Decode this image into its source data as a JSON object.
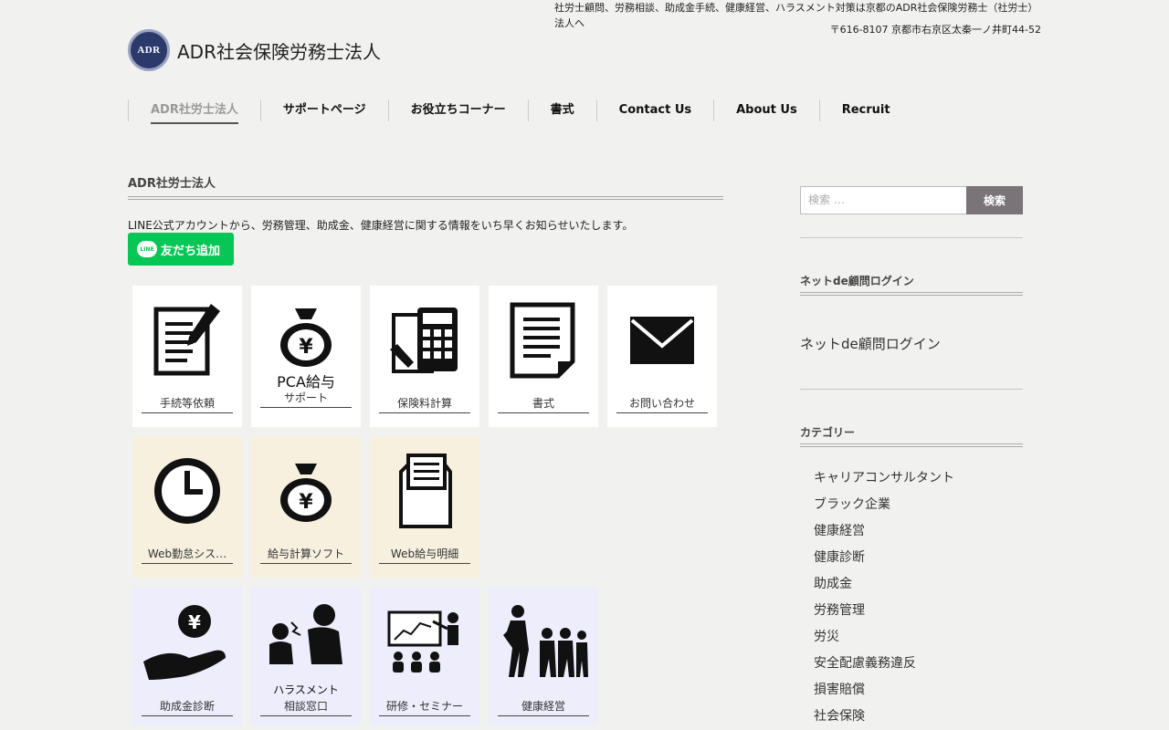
{
  "header": {
    "tagline": "社労士顧問、労務相談、助成金手続、健康経営、ハラスメント対策は京都のADR社会保険労務士（社労士）法人へ",
    "address": "〒616-8107 京都市右京区太秦一ノ井町44-52",
    "logo_mark": "ADR",
    "logo_text": "ADR社会保険労務士法人"
  },
  "nav": {
    "items": [
      {
        "label": "ADR社労士法人"
      },
      {
        "label": "サポートページ"
      },
      {
        "label": "お役立ちコーナー"
      },
      {
        "label": "書式"
      },
      {
        "label": "Contact Us"
      },
      {
        "label": "About Us"
      },
      {
        "label": "Recruit"
      }
    ]
  },
  "main": {
    "title": "ADR社労士法人",
    "line_text": "LINE公式アカウントから、労務管理、助成金、健康経営に関する情報をいち早くお知らせいたします。",
    "line_badge": "LINE",
    "line_button": "友だち追加",
    "tiles": [
      {
        "label": "手続等依頼"
      },
      {
        "label": "サポート",
        "caption": "PCA給与"
      },
      {
        "label": "保険料計算"
      },
      {
        "label": "書式"
      },
      {
        "label": "お問い合わせ"
      },
      {
        "label": "Web勤怠シス…"
      },
      {
        "label": "給与計算ソフト"
      },
      {
        "label": "Web給与明細"
      },
      {
        "label": "助成金診断"
      },
      {
        "label": "相談窓口",
        "caption": "ハラスメント"
      },
      {
        "label": "研修・セミナー"
      },
      {
        "label": "健康経営"
      }
    ]
  },
  "sidebar": {
    "search_placeholder": "検索 …",
    "search_button": "検索",
    "login_title": "ネットde顧問ログイン",
    "login_link": "ネットde顧問ログイン",
    "category_title": "カテゴリー",
    "categories": [
      "キャリアコンサルタント",
      "ブラック企業",
      "健康経営",
      "健康診断",
      "助成金",
      "労務管理",
      "労災",
      "安全配慮義務違反",
      "損害賠償",
      "社会保険"
    ]
  }
}
